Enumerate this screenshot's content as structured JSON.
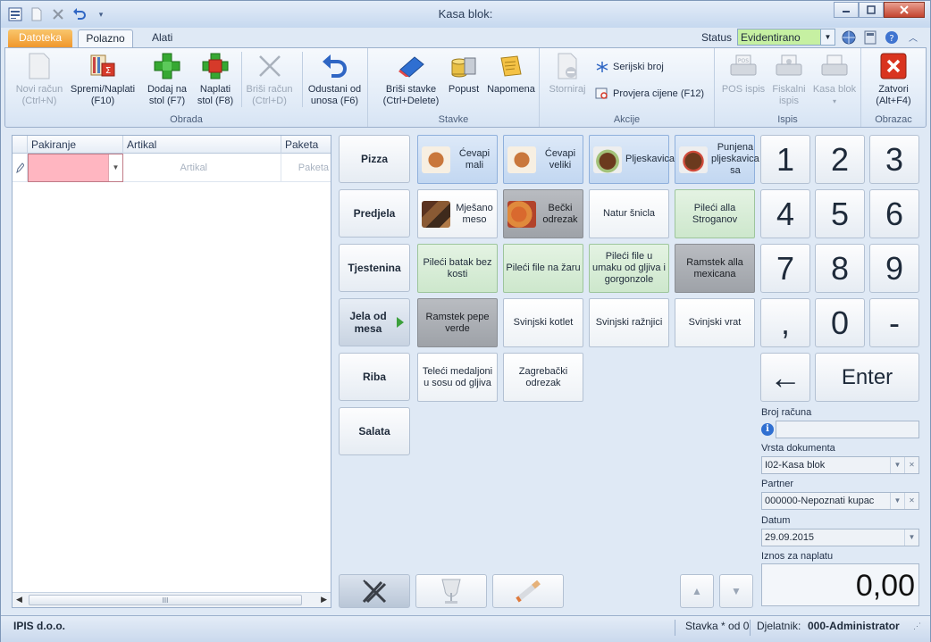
{
  "window": {
    "title": "Kasa blok:"
  },
  "tabs": {
    "file": "Datoteka",
    "home": "Polazno",
    "tools": "Alati"
  },
  "status": {
    "label": "Status",
    "value": "Evidentirano"
  },
  "ribbon": {
    "groups": {
      "obrada": "Obrada",
      "stavke": "Stavke",
      "akcije": "Akcije",
      "ispis": "Ispis",
      "obrazac": "Obrazac"
    },
    "novi_racun": [
      "Novi račun",
      "(Ctrl+N)"
    ],
    "spremi": [
      "Spremi/Naplati",
      "(F10)"
    ],
    "dodaj": [
      "Dodaj na",
      "stol (F7)"
    ],
    "naplati": [
      "Naplati",
      "stol (F8)"
    ],
    "brisi_racun": [
      "Briši račun",
      "(Ctrl+D)"
    ],
    "odustani": [
      "Odustani od",
      "unosa (F6)"
    ],
    "brisi_stavke": [
      "Briši stavke",
      "(Ctrl+Delete)"
    ],
    "popust": "Popust",
    "napomena": "Napomena",
    "storniraj": "Storniraj",
    "serijski": "Serijski broj",
    "provjera": "Provjera cijene (F12)",
    "pos": "POS ispis",
    "fiskalni": [
      "Fiskalni",
      "ispis"
    ],
    "kasa": "Kasa blok",
    "zatvori": [
      "Zatvori",
      "(Alt+F4)"
    ]
  },
  "grid": {
    "columns": [
      "Pakiranje",
      "Artikal",
      "Paketa"
    ],
    "placeholders": [
      "",
      "Artikal",
      "Paketa"
    ],
    "scroll_glyph": "III"
  },
  "categories": [
    "Pizza",
    "Predjela",
    "Tjestenina",
    "Jela od mesa",
    "Riba",
    "Salata"
  ],
  "articles": [
    [
      "Ćevapi mali",
      "Ćevapi veliki",
      "Pljeskavica",
      "Punjena pljeskavica sa"
    ],
    [
      "Mješano meso",
      "Bečki odrezak",
      "Natur šnicla",
      "Pileći alla Stroganov"
    ],
    [
      "Pileći batak bez kosti",
      "Pileći file na žaru",
      "Pileći file u umaku od gljiva i gorgonzole",
      "Ramstek alla mexicana"
    ],
    [
      "Ramstek pepe verde",
      "Svinjski kotlet",
      "Svinjski ražnjici",
      "Svinjski vrat"
    ],
    [
      "Teleći medaljoni u sosu od gljiva",
      "Zagrebački odrezak"
    ]
  ],
  "keypad": {
    "row1": [
      "1",
      "2",
      "3"
    ],
    "row2": [
      "4",
      "5",
      "6"
    ],
    "row3": [
      "7",
      "8",
      "9"
    ],
    "row4": [
      ",",
      "0",
      "-"
    ],
    "back": "←",
    "enter": "Enter"
  },
  "form": {
    "broj_racuna_label": "Broj računa",
    "broj_racuna_value": "",
    "vrsta_label": "Vrsta dokumenta",
    "vrsta_value": "I02-Kasa blok",
    "partner_label": "Partner",
    "partner_value": "000000-Nepoznati kupac",
    "datum_label": "Datum",
    "datum_value": "29.09.2015",
    "iznos_label": "Iznos za naplatu",
    "iznos_value": "0,00"
  },
  "statusbar": {
    "company": "IPIS d.o.o.",
    "stavka": "Stavka * od 0",
    "djelatnik_label": "Djelatnik:",
    "djelatnik_value": "000-Administrator"
  },
  "colors": {
    "accent_green": "#c6f0a2",
    "file_tab": "#f0972c",
    "error_cell": "#ffb6c1",
    "close_red": "#d9341f"
  }
}
